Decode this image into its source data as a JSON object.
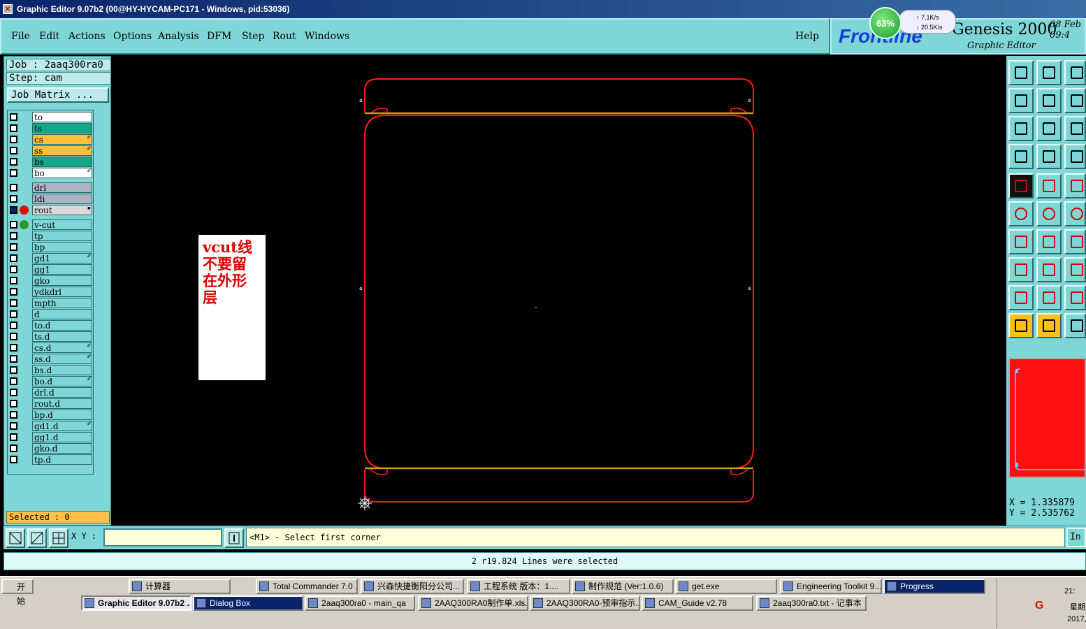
{
  "window": {
    "title": "Graphic Editor 9.07b2 (00@HY-HYCAM-PC171 - Windows, pid:53036)"
  },
  "menu": {
    "items": [
      "File",
      "Edit",
      "Actions",
      "Options",
      "Analysis",
      "DFM",
      "Step",
      "Rout",
      "Windows"
    ],
    "help": "Help"
  },
  "logo": {
    "brand": "Frontline",
    "product": "Genesis 2000",
    "subtitle": "Graphic Editor",
    "date": "08 Feb",
    "time": "09:4"
  },
  "net_widget": {
    "percent": "63%",
    "up_rate": "7.1K/s",
    "down_rate": "20.5K/s"
  },
  "job": {
    "job_line": "Job : 2aaq300ra0",
    "step_line": "Step: cam",
    "matrix_label": "Job Matrix ..."
  },
  "layers": [
    {
      "name": "to",
      "color": "#ffffff",
      "mark": ""
    },
    {
      "name": "ts",
      "color": "#14a889",
      "mark": ""
    },
    {
      "name": "cs",
      "color": "#ffbf3a",
      "mark": "✐"
    },
    {
      "name": "ss",
      "color": "#ffbf3a",
      "mark": "✐"
    },
    {
      "name": "bs",
      "color": "#14a889",
      "mark": ""
    },
    {
      "name": "bo",
      "color": "#ffffff",
      "mark": "✐"
    },
    {
      "name": "drl",
      "color": "#aab4c4",
      "mark": ""
    },
    {
      "name": "ldi",
      "color": "#aab4c4",
      "mark": ""
    },
    {
      "name": "rout",
      "color": "#d8d8d8",
      "mark": "▪"
    },
    {
      "name": "v-cut",
      "color": "#7fd6d6",
      "mark": ""
    },
    {
      "name": "tp",
      "color": "#7fd6d6",
      "mark": ""
    },
    {
      "name": "bp",
      "color": "#7fd6d6",
      "mark": ""
    },
    {
      "name": "gd1",
      "color": "#7fd6d6",
      "mark": "✐"
    },
    {
      "name": "gg1",
      "color": "#7fd6d6",
      "mark": ""
    },
    {
      "name": "gko",
      "color": "#7fd6d6",
      "mark": ""
    },
    {
      "name": "ydkdrl",
      "color": "#7fd6d6",
      "mark": ""
    },
    {
      "name": "mpth",
      "color": "#7fd6d6",
      "mark": ""
    },
    {
      "name": "d",
      "color": "#7fd6d6",
      "mark": ""
    },
    {
      "name": "to.d",
      "color": "#7fd6d6",
      "mark": ""
    },
    {
      "name": "ts.d",
      "color": "#7fd6d6",
      "mark": ""
    },
    {
      "name": "cs.d",
      "color": "#7fd6d6",
      "mark": "✐"
    },
    {
      "name": "ss.d",
      "color": "#7fd6d6",
      "mark": "✐"
    },
    {
      "name": "bs.d",
      "color": "#7fd6d6",
      "mark": ""
    },
    {
      "name": "bo.d",
      "color": "#7fd6d6",
      "mark": "✐"
    },
    {
      "name": "drl.d",
      "color": "#7fd6d6",
      "mark": ""
    },
    {
      "name": "rout.d",
      "color": "#7fd6d6",
      "mark": ""
    },
    {
      "name": "bp.d",
      "color": "#7fd6d6",
      "mark": ""
    },
    {
      "name": "gd1.d",
      "color": "#7fd6d6",
      "mark": "✐"
    },
    {
      "name": "gg1.d",
      "color": "#7fd6d6",
      "mark": ""
    },
    {
      "name": "gko.d",
      "color": "#7fd6d6",
      "mark": ""
    },
    {
      "name": "tp.d",
      "color": "#7fd6d6",
      "mark": ""
    }
  ],
  "selected_label": "Selected : 0",
  "canvas": {
    "note_lines": [
      "vcut线",
      "不要留",
      "在外形",
      "层"
    ],
    "outline_color": "#ff1a1a",
    "vcut_color": "#c8a000"
  },
  "coords": {
    "x": "X = 1.335879",
    "y": "Y = 2.535762"
  },
  "command": {
    "xy_label": "X Y :",
    "xy_value": "",
    "prompt": "<M1> - Select first corner",
    "in_button": "In"
  },
  "status": "2 r19.824 Lines were selected",
  "taskbar": {
    "start": "开始",
    "row1": [
      "计算器",
      "Total Commander 7.0 ...",
      "兴森快捷衡阳分公司...",
      "工程系统  版本：1....",
      "制作规范 (Ver:1.0.6)",
      "get.exe",
      "Engineering Toolkit 9....",
      "Progress"
    ],
    "row2": [
      "Graphic Editor 9.07b2 ...",
      "Dialog Box",
      "2aaq300ra0 - main_qa",
      "2AAQ300RA0制作单.xls...",
      "2AAQ300RA0-预审指示...",
      "CAM_Guide v2.78",
      "2aaq300ra0.txt - 记事本"
    ],
    "tray_time": "21:",
    "tray_day": "星期",
    "tray_year": "2017,"
  }
}
